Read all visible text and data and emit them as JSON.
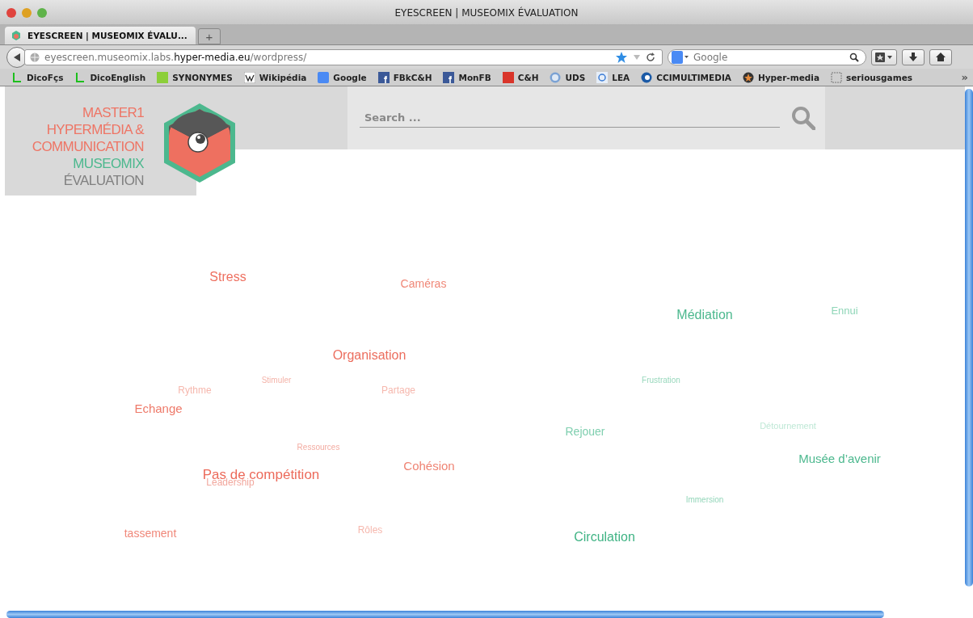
{
  "window": {
    "title": "EYESCREEN | MUSEOMIX ÉVALUATION"
  },
  "tabs": [
    {
      "label": "EYESCREEN | MUSEOMIX ÉVALU...",
      "selected": true
    }
  ],
  "new_tab": "+",
  "address": {
    "host_pre": "eyescreen.museomix.labs.",
    "host": "hyper-media.eu",
    "path": "/wordpress/"
  },
  "search_engine": {
    "placeholder": "Google"
  },
  "bookmarks": [
    {
      "label": "DicoFçs",
      "kind": "l"
    },
    {
      "label": "DicoEnglish",
      "kind": "l"
    },
    {
      "label": "SYNONYMES",
      "kind": "ok"
    },
    {
      "label": "Wikipédia",
      "kind": "w"
    },
    {
      "label": "Google",
      "kind": "g"
    },
    {
      "label": "FBkC&H",
      "kind": "f"
    },
    {
      "label": "MonFB",
      "kind": "f"
    },
    {
      "label": "C&H",
      "kind": "fae"
    },
    {
      "label": "UDS",
      "kind": "uds"
    },
    {
      "label": "LEA",
      "kind": "e"
    },
    {
      "label": "CCIMULTIMEDIA",
      "kind": "cci"
    },
    {
      "label": "Hyper-media",
      "kind": "star"
    },
    {
      "label": "seriousgames",
      "kind": "folder"
    }
  ],
  "bookmarks_more": "»",
  "site": {
    "logo_lines": [
      {
        "text": "MASTER1",
        "color": "#ee7565"
      },
      {
        "text": "HYPERMÉDIA &",
        "color": "#ee7565"
      },
      {
        "text": "COMMUNICATION",
        "color": "#ee7565"
      },
      {
        "text": "MUSEOMIX",
        "color": "#4cb88e"
      },
      {
        "text": "ÉVALUATION",
        "color": "#808080"
      }
    ],
    "search": {
      "placeholder": "Search ..."
    }
  },
  "word_cloud": [
    {
      "text": "Stress",
      "color": "#ee7060"
    },
    {
      "text": "Caméras",
      "color": "#f08878"
    },
    {
      "text": "Médiation",
      "color": "#4cb88e"
    },
    {
      "text": "Ennui",
      "color": "#8fd6b8"
    },
    {
      "text": "Organisation",
      "color": "#ec6e5e"
    },
    {
      "text": "Stimuler",
      "color": "#f4b4aa"
    },
    {
      "text": "Rythme",
      "color": "#f6b8ae"
    },
    {
      "text": "Partage",
      "color": "#f6b8ae"
    },
    {
      "text": "Frustration",
      "color": "#99d8bd"
    },
    {
      "text": "Echange",
      "color": "#ee7a6a"
    },
    {
      "text": "Rejouer",
      "color": "#7fcfaf"
    },
    {
      "text": "Détournement",
      "color": "#bfe8d6"
    },
    {
      "text": "Ressources",
      "color": "#f3aca2"
    },
    {
      "text": "Musée d’avenir",
      "color": "#4cb88e"
    },
    {
      "text": "Cohésion",
      "color": "#ef8474"
    },
    {
      "text": "Leadership",
      "color": "#f2a89e"
    },
    {
      "text": "Pas de compétition",
      "color": "#ec6a5a"
    },
    {
      "text": "Immersion",
      "color": "#94d6ba"
    },
    {
      "text": "tassement",
      "color": "#f0887a"
    },
    {
      "text": "Rôles",
      "color": "#f6b8ae"
    },
    {
      "text": "Circulation",
      "color": "#3fb384"
    }
  ]
}
